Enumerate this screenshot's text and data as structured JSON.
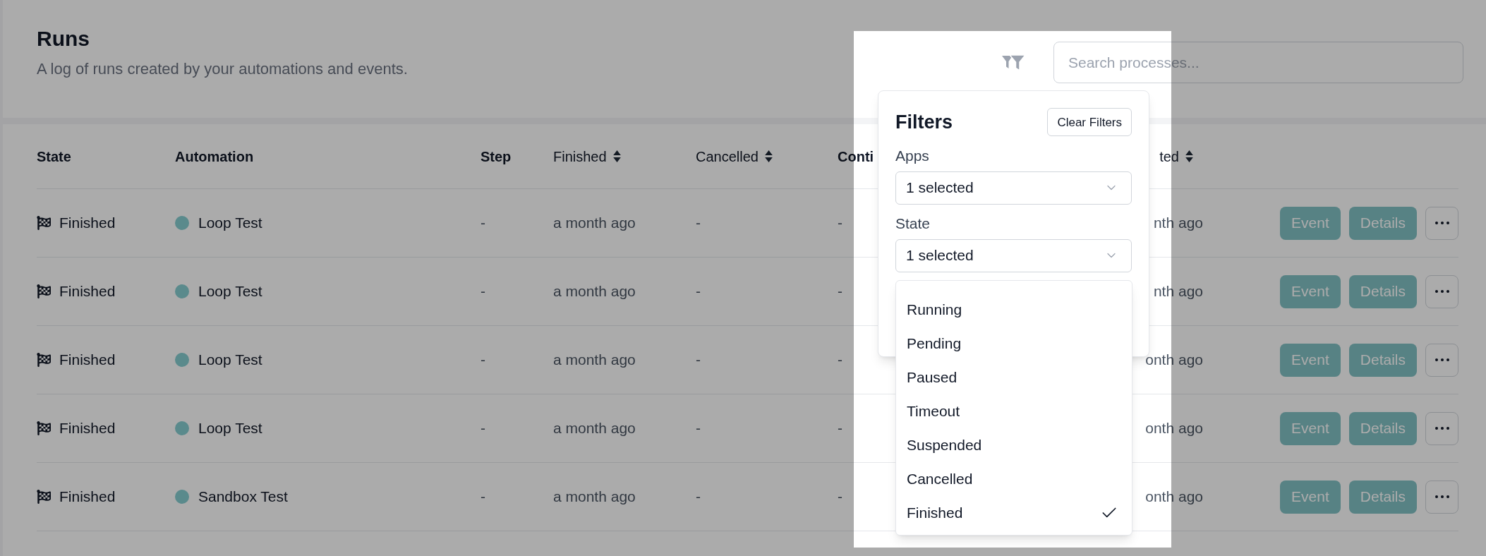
{
  "header": {
    "title": "Runs",
    "subtitle": "A log of runs created by your automations and events."
  },
  "search": {
    "placeholder": "Search processes..."
  },
  "filters": {
    "title": "Filters",
    "clear_button": "Clear Filters",
    "fields": [
      {
        "label": "Apps",
        "value": "1 selected"
      },
      {
        "label": "State",
        "value": "1 selected",
        "options": [
          {
            "label": "Running",
            "selected": false
          },
          {
            "label": "Pending",
            "selected": false
          },
          {
            "label": "Paused",
            "selected": false
          },
          {
            "label": "Timeout",
            "selected": false
          },
          {
            "label": "Suspended",
            "selected": false
          },
          {
            "label": "Cancelled",
            "selected": false
          },
          {
            "label": "Finished",
            "selected": true
          }
        ]
      }
    ]
  },
  "table": {
    "columns": [
      {
        "label": "State",
        "kind": "status",
        "sortable": false
      },
      {
        "label": "Automation",
        "kind": "app",
        "sortable": false
      },
      {
        "label": "Step",
        "kind": "text",
        "sortable": false
      },
      {
        "label": "Finished",
        "kind": "text",
        "sortable": true
      },
      {
        "label": "Cancelled",
        "kind": "text",
        "sortable": true
      },
      {
        "label": "Conti",
        "kind": "text",
        "sortable": false
      },
      {
        "label": "ted",
        "kind": "text",
        "sortable": true
      }
    ],
    "rows": [
      {
        "cells": [
          "Finished",
          "Loop Test",
          "-",
          "a month ago",
          "-",
          "-",
          "nth ago"
        ],
        "buttons": [
          "Event",
          "Details"
        ]
      },
      {
        "cells": [
          "Finished",
          "Loop Test",
          "-",
          "a month ago",
          "-",
          "-",
          "nth ago"
        ],
        "buttons": [
          "Event",
          "Details"
        ]
      },
      {
        "cells": [
          "Finished",
          "Loop Test",
          "-",
          "a month ago",
          "-",
          "-",
          "onth ago"
        ],
        "buttons": [
          "Event",
          "Details"
        ]
      },
      {
        "cells": [
          "Finished",
          "Loop Test",
          "-",
          "a month ago",
          "-",
          "-",
          "onth ago"
        ],
        "buttons": [
          "Event",
          "Details"
        ]
      },
      {
        "cells": [
          "Finished",
          "Sandbox Test",
          "-",
          "a month ago",
          "-",
          "-",
          "onth ago"
        ],
        "buttons": [
          "Event",
          "Details"
        ]
      }
    ]
  }
}
